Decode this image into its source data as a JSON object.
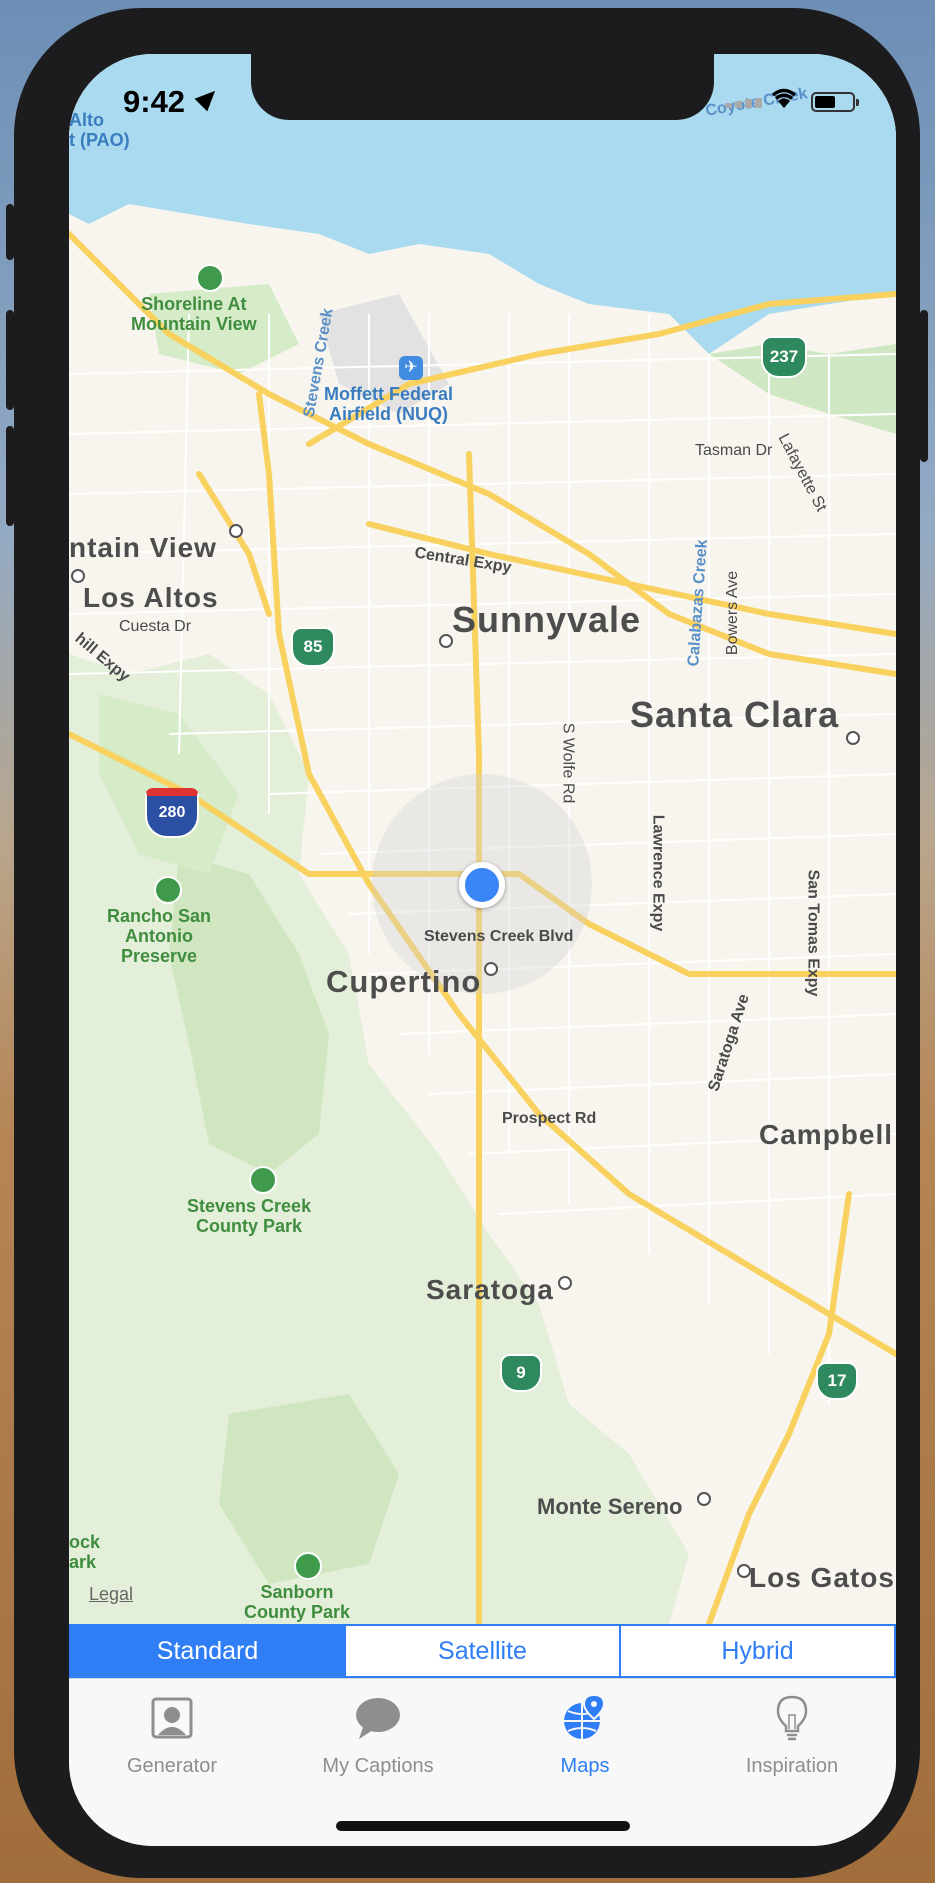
{
  "status_bar": {
    "time": "9:42"
  },
  "map": {
    "cities": [
      "Sunnyvale",
      "Santa Clara",
      "Cupertino",
      "Saratoga",
      "Campbell",
      "Los Altos",
      "ntain View",
      "Los Gatos",
      "Monte Sereno"
    ],
    "parks": [
      "Shoreline At\nMountain View",
      "Rancho San\nAntonio\nPreserve",
      "Stevens Creek\nCounty Park",
      "Sanborn\nCounty Park",
      "ock\nark"
    ],
    "streets": [
      "Central Expy",
      "Stevens Creek Blvd",
      "Prospect Rd",
      "Tasman Dr",
      "Lafayette St",
      "Bowers Ave",
      "S Wolfe Rd",
      "Lawrence Expy",
      "San Tomas Expy",
      "Saratoga Ave",
      "Cuesta Dr",
      "hill Expy"
    ],
    "water_labels": [
      "Stevens Creek",
      "Calabazas Creek",
      "Coyote Creek"
    ],
    "airports": [
      "Moffett Federal\nAirfield (NUQ)",
      "Alto\nt (PAO)"
    ],
    "highways": [
      "237",
      "85",
      "280",
      "9",
      "17"
    ],
    "legal": "Legal"
  },
  "segmented": {
    "items": [
      "Standard",
      "Satellite",
      "Hybrid"
    ],
    "selected": "Standard"
  },
  "tabs": [
    {
      "label": "Generator",
      "icon": "portrait-icon",
      "active": false
    },
    {
      "label": "My Captions",
      "icon": "speech-bubble-icon",
      "active": false
    },
    {
      "label": "Maps",
      "icon": "globe-pin-icon",
      "active": true
    },
    {
      "label": "Inspiration",
      "icon": "lightbulb-icon",
      "active": false
    }
  ],
  "colors": {
    "accent": "#2f7ef6",
    "water": "#a9daf0",
    "land": "#f8f5ee",
    "park": "#d8eacb",
    "road": "#f8d15e",
    "shield": "#2e8a5e"
  }
}
